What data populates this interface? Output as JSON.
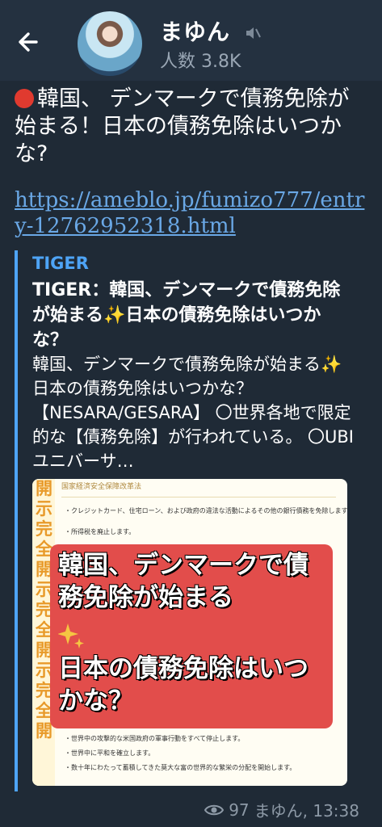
{
  "header": {
    "channel_name": "まゆん",
    "members": "人数 3.8K"
  },
  "message": {
    "headline": "韓国、 デンマークで債務免除が始まる！日本の債務免除はいつかな?",
    "link": "https://ameblo.jp/fumizo777/entry-12762952318.html",
    "preview": {
      "site": "TIGER",
      "title": "TIGER：韓国、デンマークで債務免除が始まる✨日本の債務免除はいつかな？",
      "description": "韓国、デンマークで債務免除が始まる✨日本の債務免除はいつかな？【NESARA/GESARA】 〇世界各地で限定的な【債務免除】が行われている。 〇UBIユニバーサ…",
      "image": {
        "side_text": "開示 完全開示 完全開示 完全開",
        "doc_heading": "国家経済安全保障改革法",
        "doc_lines": [
          "・クレジットカード、住宅ローン、および政府の違法な活動によるその他の銀行債務を免除します。",
          "・所得税を廃止します。",
          "・世界中の攻撃的な米国政府の軍事行動をすべて停止します。",
          "・世界中に平和を確立します。",
          "・数十年にわたって蓄積してきた莫大な富の世界的な繁栄の分配を開始します。"
        ],
        "card_line1": "韓国、デンマークで債務免除が始まる",
        "card_line2": "日本の債務免除はいつかな？"
      }
    },
    "views": "97",
    "author_time": "まゆん, 13:38"
  },
  "colors": {
    "background": "#1f2a36",
    "link": "#6aa8e6",
    "accent": "#4ea4f6",
    "card": "#e24d4b"
  }
}
